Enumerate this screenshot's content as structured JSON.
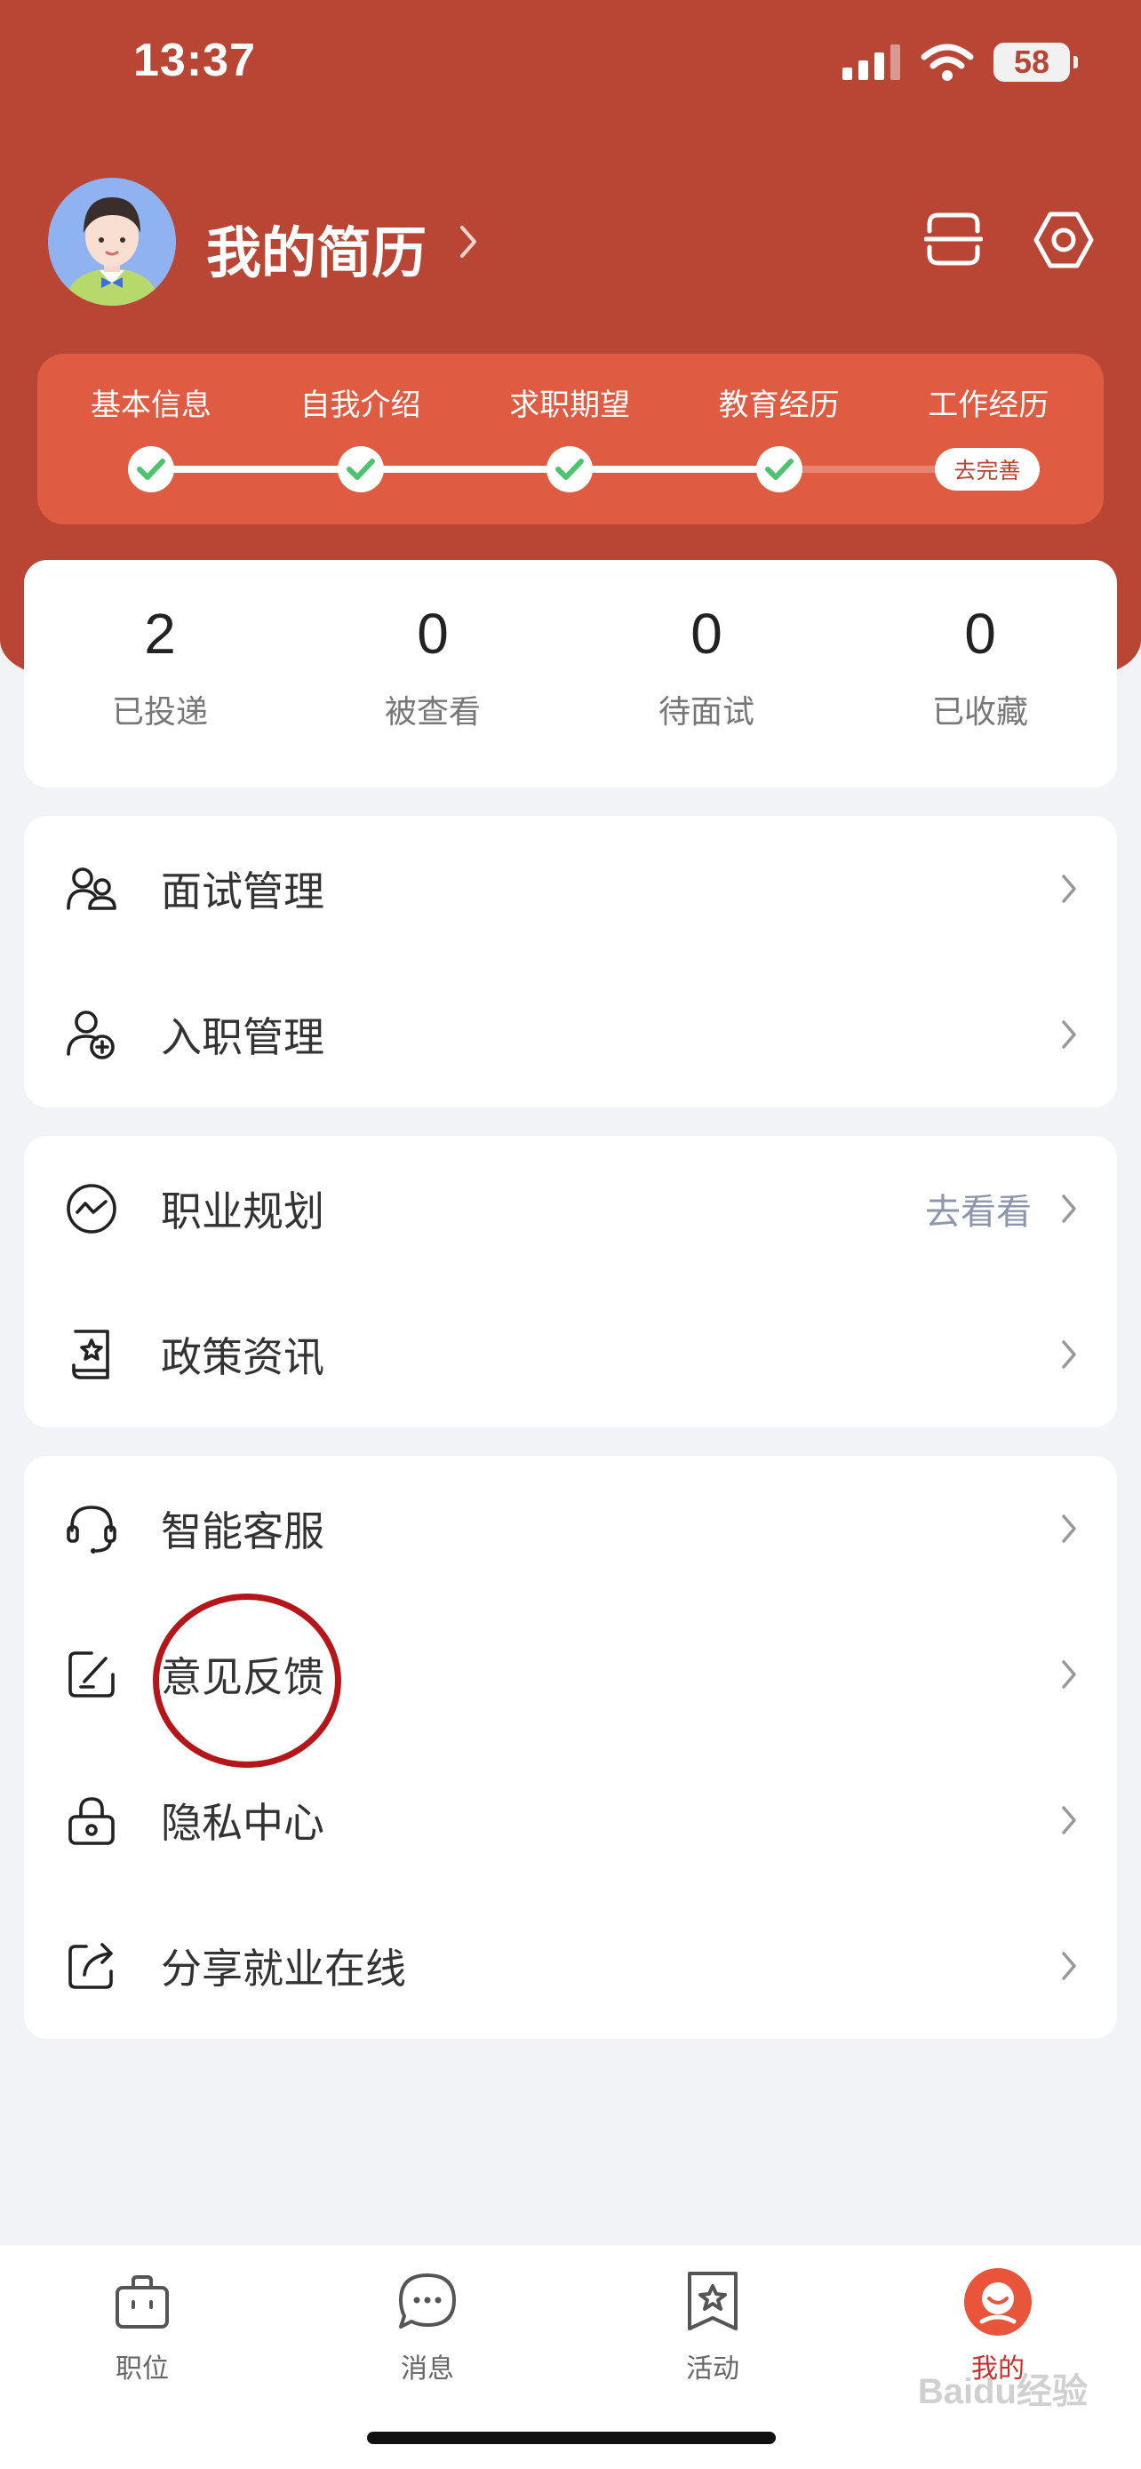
{
  "status_bar": {
    "time": "13:37",
    "battery": "58"
  },
  "header": {
    "resume_title": "我的简历"
  },
  "progress": {
    "steps": [
      "基本信息",
      "自我介绍",
      "求职期望",
      "教育经历",
      "工作经历"
    ],
    "completed_steps": 4,
    "action_label": "去完善"
  },
  "stats": [
    {
      "value": "2",
      "label": "已投递"
    },
    {
      "value": "0",
      "label": "被查看"
    },
    {
      "value": "0",
      "label": "待面试"
    },
    {
      "value": "0",
      "label": "已收藏"
    }
  ],
  "menu_groups": [
    {
      "items": [
        {
          "label": "面试管理",
          "icon": "interview-users-icon"
        },
        {
          "label": "入职管理",
          "icon": "user-add-icon"
        }
      ]
    },
    {
      "items": [
        {
          "label": "职业规划",
          "icon": "career-wave-icon",
          "extra": "去看看"
        },
        {
          "label": "政策资讯",
          "icon": "policy-doc-icon"
        }
      ]
    },
    {
      "items": [
        {
          "label": "智能客服",
          "icon": "headset-icon"
        },
        {
          "label": "意见反馈",
          "icon": "feedback-edit-icon"
        },
        {
          "label": "隐私中心",
          "icon": "lock-icon"
        },
        {
          "label": "分享就业在线",
          "icon": "share-icon"
        }
      ]
    }
  ],
  "tabbar": [
    {
      "label": "职位",
      "icon": "briefcase-icon",
      "active": false
    },
    {
      "label": "消息",
      "icon": "chat-icon",
      "active": false
    },
    {
      "label": "活动",
      "icon": "activity-star-icon",
      "active": false
    },
    {
      "label": "我的",
      "icon": "profile-icon",
      "active": true
    }
  ],
  "colors": {
    "brand": "#b94634",
    "progress_card": "#df5b42",
    "check": "#4cc46e",
    "active_tab": "#c9302c"
  },
  "watermark": "Baidu经验"
}
